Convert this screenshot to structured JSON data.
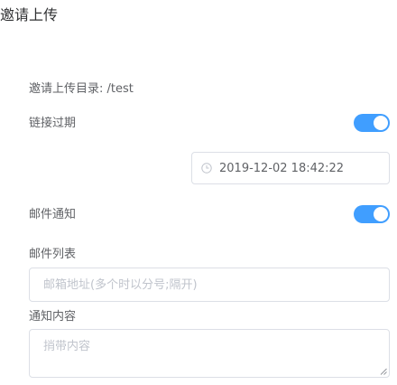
{
  "dialog": {
    "title": "邀请上传"
  },
  "directory": {
    "label": "邀请上传目录:",
    "value": "/test"
  },
  "link_expiry": {
    "label": "链接过期",
    "enabled": true,
    "datetime": "2019-12-02 18:42:22"
  },
  "email_notify": {
    "label": "邮件通知",
    "enabled": true
  },
  "email_list": {
    "label": "邮件列表",
    "placeholder": "邮箱地址(多个时以分号;隔开)",
    "value": ""
  },
  "notify_content": {
    "label": "通知内容",
    "placeholder": "捎带内容",
    "value": ""
  },
  "icons": {
    "datetime": "clock-icon",
    "resize": "resize-grip-icon"
  },
  "colors": {
    "accent": "#409eff",
    "border": "#dcdfe6",
    "placeholder": "#c0c4cc"
  }
}
